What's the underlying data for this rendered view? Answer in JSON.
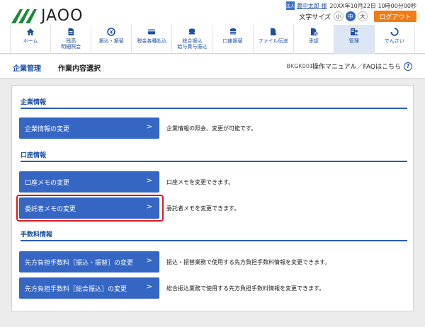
{
  "header": {
    "brand": "JAOO",
    "user": {
      "badge": "法人",
      "name": "農中太郎 様",
      "login_time": "20XX年10月22日 10時00分00秒"
    },
    "font_size": {
      "label": "文字サイズ",
      "options": [
        "小",
        "中",
        "大"
      ],
      "selected": "中"
    },
    "logout_label": "ログアウト",
    "nav": [
      {
        "label": "ホーム",
        "icon": "home-icon"
      },
      {
        "label": "残高\n明細照会",
        "icon": "document-icon"
      },
      {
        "label": "振込・振替",
        "icon": "yen-icon"
      },
      {
        "label": "税金各種払込",
        "icon": "card-icon"
      },
      {
        "label": "総合振込\n給与賞与振込",
        "icon": "coins-icon"
      },
      {
        "label": "口座振替",
        "icon": "coins-stack-icon"
      },
      {
        "label": "ファイル伝送",
        "icon": "file-transfer-icon"
      },
      {
        "label": "承認",
        "icon": "approve-icon"
      },
      {
        "label": "管理",
        "icon": "manage-icon",
        "active": true
      },
      {
        "label": "でんさい",
        "icon": "densai-icon"
      }
    ]
  },
  "titlebar": {
    "main": "企業管理",
    "sub": "作業内容選択",
    "code": "BKGK001",
    "help_text": "操作マニュアル／FAQはこちら",
    "help_icon": "?"
  },
  "sections": [
    {
      "title": "企業情報",
      "actions": [
        {
          "label": "企業情報の変更",
          "desc": "企業情報の照会、変更が可能です。"
        }
      ]
    },
    {
      "title": "口座情報",
      "actions": [
        {
          "label": "口座メモの変更",
          "desc": "口座メモを変更できます。"
        },
        {
          "label": "委託者メモの変更",
          "desc": "委託者メモを変更できます。",
          "highlighted": true
        }
      ]
    },
    {
      "title": "手数料情報",
      "actions": [
        {
          "label": "先方負担手数料［振込・振替］の変更",
          "desc": "振込・振替業務で使用する先方負担手数料情報を変更できます。"
        },
        {
          "label": "先方負担手数料［総合振込］の変更",
          "desc": "総合振込業務で使用する先方負担手数料情報を変更できます。"
        }
      ]
    }
  ],
  "chevron": ">",
  "colors": {
    "accent": "#3566c3",
    "logout": "#f07c16",
    "highlight": "#e21818"
  }
}
